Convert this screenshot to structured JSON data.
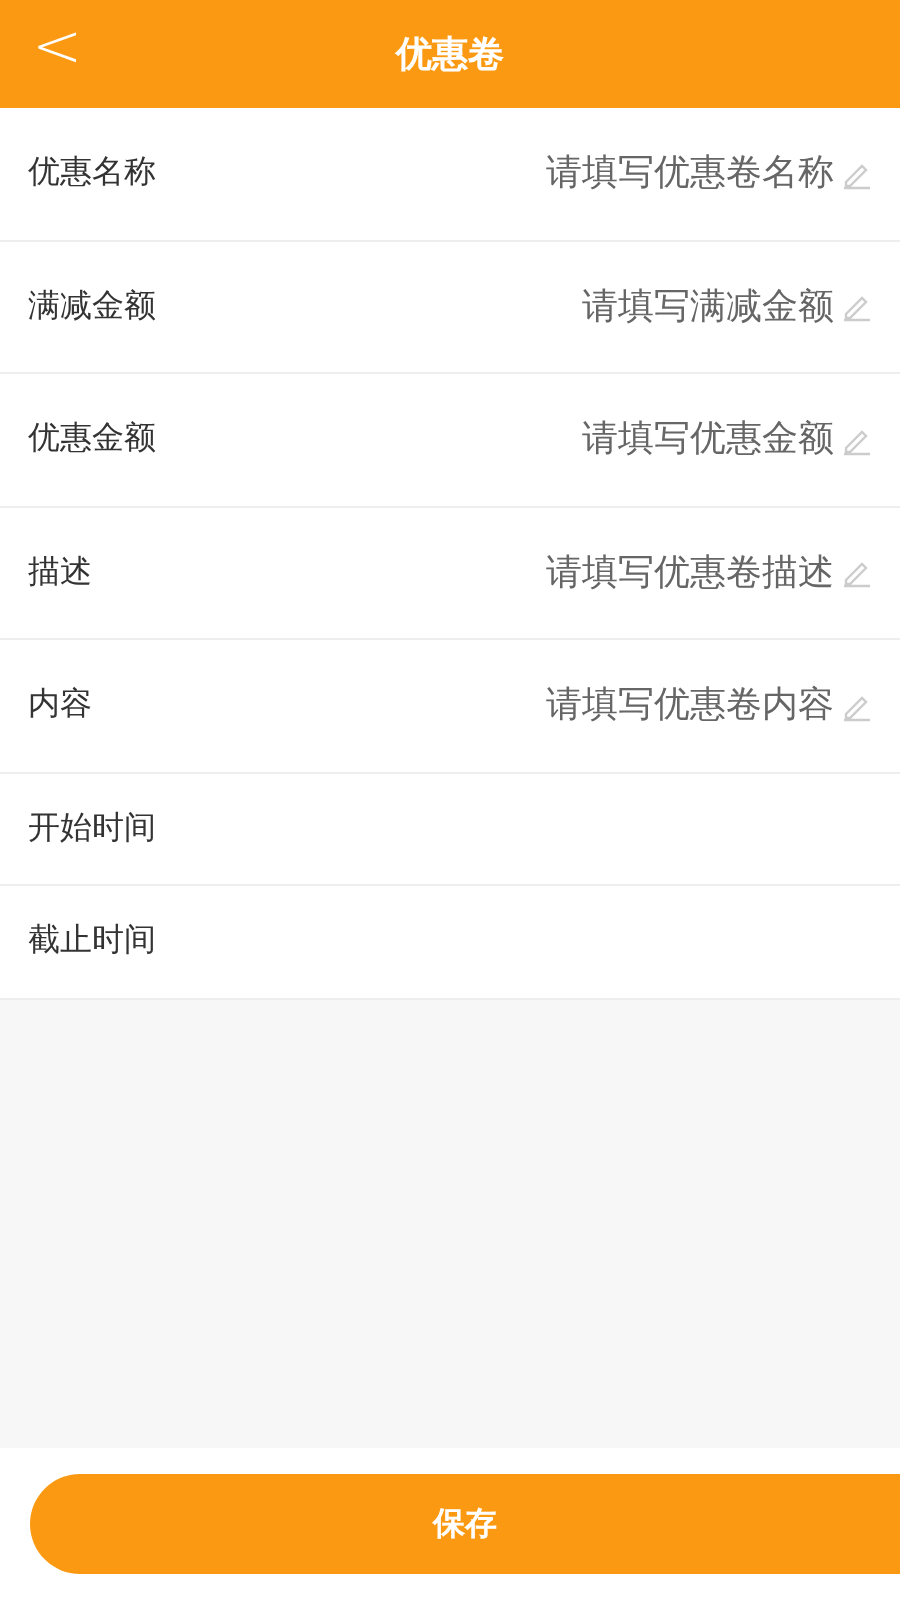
{
  "header": {
    "back": "<",
    "title": "优惠卷"
  },
  "fields": [
    {
      "kind": "input",
      "label": "优惠名称",
      "placeholder": "请填写优惠卷名称"
    },
    {
      "kind": "input",
      "label": "满减金额",
      "placeholder": "请填写满减金额"
    },
    {
      "kind": "input",
      "label": "优惠金额",
      "placeholder": "请填写优惠金额"
    },
    {
      "kind": "input",
      "label": "描述",
      "placeholder": "请填写优惠卷描述"
    },
    {
      "kind": "input",
      "label": "内容",
      "placeholder": "请填写优惠卷内容"
    },
    {
      "kind": "picker",
      "label": "开始时间"
    },
    {
      "kind": "picker",
      "label": "截止时间"
    }
  ],
  "save_button": "保存"
}
